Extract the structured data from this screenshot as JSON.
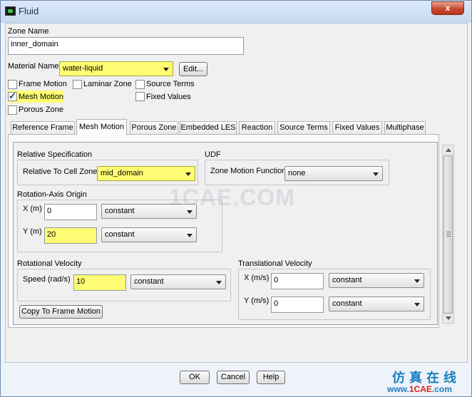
{
  "window": {
    "title": "Fluid",
    "close_glyph": "x"
  },
  "zone_name": {
    "label": "Zone Name",
    "value": "inner_domain"
  },
  "material": {
    "label": "Material Name",
    "value": "water-liquid",
    "edit_label": "Edit..."
  },
  "options": {
    "frame_motion": {
      "label": "Frame Motion",
      "checked": false
    },
    "laminar_zone": {
      "label": "Laminar Zone",
      "checked": false
    },
    "source_terms": {
      "label": "Source Terms",
      "checked": false
    },
    "mesh_motion": {
      "label": "Mesh Motion",
      "checked": true
    },
    "fixed_values": {
      "label": "Fixed Values",
      "checked": false
    },
    "porous_zone": {
      "label": "Porous Zone",
      "checked": false
    }
  },
  "tabs": [
    {
      "label": "Reference Frame",
      "active": false
    },
    {
      "label": "Mesh Motion",
      "active": true
    },
    {
      "label": "Porous Zone",
      "active": false
    },
    {
      "label": "Embedded LES",
      "active": false
    },
    {
      "label": "Reaction",
      "active": false
    },
    {
      "label": "Source Terms",
      "active": false
    },
    {
      "label": "Fixed Values",
      "active": false
    },
    {
      "label": "Multiphase",
      "active": false
    }
  ],
  "mesh_motion": {
    "relative_spec": {
      "title": "Relative Specification",
      "label": "Relative To Cell Zone",
      "value": "mid_domain"
    },
    "udf": {
      "title": "UDF",
      "label": "Zone Motion Function",
      "value": "none"
    },
    "rotation_axis_origin": {
      "title": "Rotation-Axis Origin",
      "x_label": "X (m)",
      "x_value": "0",
      "x_mode": "constant",
      "y_label": "Y (m)",
      "y_value": "20",
      "y_mode": "constant"
    },
    "rotational_velocity": {
      "title": "Rotational Velocity",
      "speed_label": "Speed (rad/s)",
      "speed_value": "10",
      "speed_mode": "constant",
      "copy_button": "Copy To Frame Motion"
    },
    "translational_velocity": {
      "title": "Translational Velocity",
      "x_label": "X (m/s)",
      "x_value": "0",
      "x_mode": "constant",
      "y_label": "Y (m/s)",
      "y_value": "0",
      "y_mode": "constant"
    }
  },
  "buttons": {
    "ok": "OK",
    "cancel": "Cancel",
    "help": "Help"
  },
  "watermark": "1CAE.COM",
  "branding": {
    "logo_cn": "仿真在线",
    "url_prefix": "www.",
    "url_brand": "1CAE",
    "url_suffix": ".com"
  },
  "colors": {
    "highlight": "#fffd73",
    "close_button": "#c9492f",
    "brand_blue": "#1a7fc0",
    "brand_red": "#d6281c"
  }
}
